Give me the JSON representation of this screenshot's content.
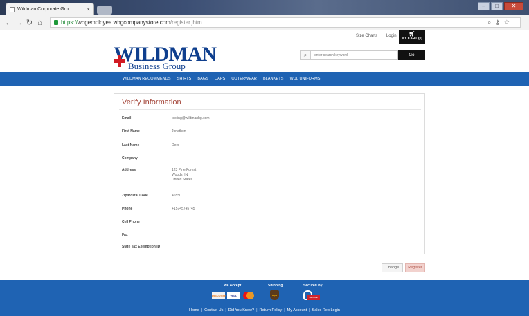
{
  "browser": {
    "tab_title": "Wildman Corporate Gro",
    "tab_close": "×",
    "url_scheme": "https://",
    "url_host": "wbgemployee.wbgcompanystore.com",
    "url_path": "/register.jhtm"
  },
  "header": {
    "size_charts": "Size Charts",
    "separator": "|",
    "login": "Login",
    "cart_label": "MY CART (0)",
    "logo_main": "ILDMAN",
    "logo_letter": "W",
    "logo_sub": "Business Group",
    "search_placeholder": "enter search keyword",
    "search_button": "Go"
  },
  "nav": {
    "items": [
      "WILDMAN RECOMMENDS",
      "SHIRTS",
      "BAGS",
      "CAPS",
      "OUTERWEAR",
      "BLANKETS",
      "WUL UNIFORMS"
    ]
  },
  "verify": {
    "title": "Verify Information",
    "fields": [
      {
        "label": "Email",
        "value": "testing@wildmanbg.com"
      },
      {
        "label": "First Name",
        "value": "Jonathon"
      },
      {
        "label": "Last Name",
        "value": "Deer"
      },
      {
        "label": "Company",
        "value": ""
      },
      {
        "label": "Address",
        "lines": [
          "123 Pine Forest",
          "Woods, IN",
          "United States"
        ]
      },
      {
        "label": "Zip/Postal Code",
        "value": "46550"
      },
      {
        "label": "Phone",
        "value": "+15745745745"
      },
      {
        "label": "Cell Phone",
        "value": ""
      },
      {
        "label": "Fax",
        "value": ""
      },
      {
        "label": "State Tax Exemption ID",
        "value": ""
      }
    ],
    "change_button": "Change",
    "register_button": "Register"
  },
  "footer": {
    "we_accept": "We Accept",
    "shipping": "Shipping",
    "secured_by": "Secured By",
    "card_discover": "DISCOVER",
    "card_visa": "VISA",
    "ups": "ups",
    "secure_badge": "SECURE",
    "links": [
      "Home",
      "Contact Us",
      "Did You Know?",
      "Return Policy",
      "My Account",
      "Sales Rep Login"
    ]
  },
  "colors": {
    "brand_blue": "#1f63b3",
    "logo_blue": "#0f3f8e",
    "logo_red": "#d21b24",
    "title_red": "#a4463a"
  }
}
